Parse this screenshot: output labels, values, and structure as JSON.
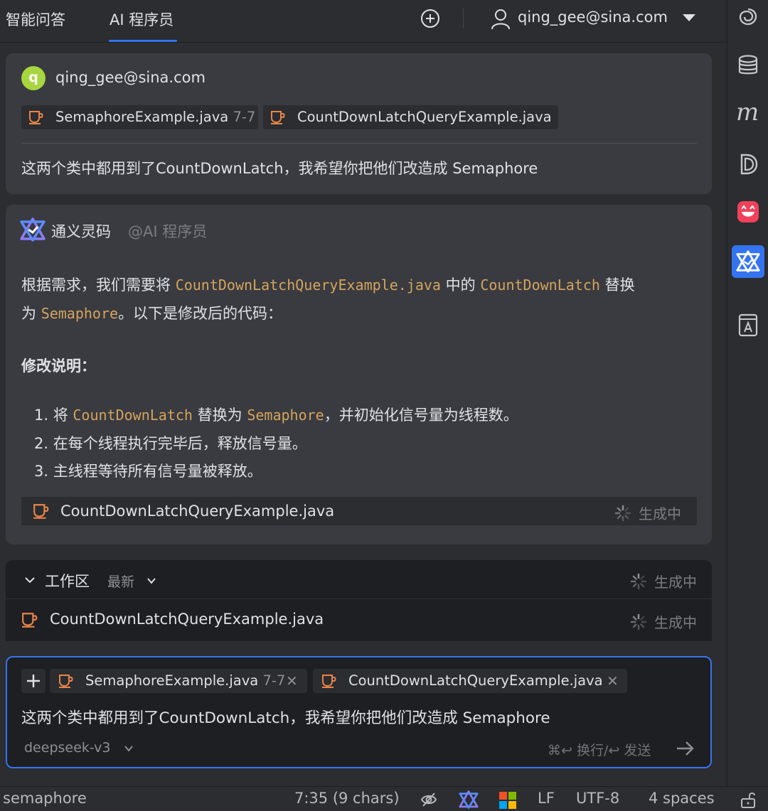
{
  "header": {
    "tabs": [
      {
        "label": "智能问答",
        "active": false
      },
      {
        "label": "AI 程序员",
        "active": true
      }
    ],
    "user_email": "qing_gee@sina.com"
  },
  "user_message": {
    "avatar_letter": "q",
    "user_name": "qing_gee@sina.com",
    "attachments": [
      {
        "file": "SemaphoreExample.java",
        "range": "7-7"
      },
      {
        "file": "CountDownLatchQueryExample.java",
        "range": ""
      }
    ],
    "text": "这两个类中都用到了CountDownLatch，我希望你把他们改造成 Semaphore"
  },
  "ai_message": {
    "name": "通义灵码",
    "mention": "@AI 程序员",
    "intro": {
      "p1": "根据需求，我们需要将 ",
      "c1": "CountDownLatchQueryExample.java",
      "p2": " 中的 ",
      "c2": "CountDownLatch",
      "p3": " 替换",
      "p4": "为 ",
      "c3": "Semaphore",
      "p5": "。以下是修改后的代码："
    },
    "section_title": "修改说明：",
    "steps": [
      {
        "n": "1. 将 ",
        "code1": "CountDownLatch",
        "mid": " 替换为 ",
        "code2": "Semaphore",
        "tail": "，并初始化信号量为线程数。"
      },
      {
        "text": "2. 在每个线程执行完毕后，释放信号量。"
      },
      {
        "text": "3. 主线程等待所有信号量被释放。"
      }
    ],
    "file": {
      "name": "CountDownLatchQueryExample.java",
      "status": "生成中"
    }
  },
  "workspace": {
    "title": "工作区",
    "filter": "最新",
    "status": "生成中",
    "files": [
      {
        "name": "CountDownLatchQueryExample.java",
        "status": "生成中"
      }
    ]
  },
  "input": {
    "attachments": [
      {
        "file": "SemaphoreExample.java",
        "range": "7-7"
      },
      {
        "file": "CountDownLatchQueryExample.java",
        "range": ""
      }
    ],
    "text": "这两个类中都用到了CountDownLatch，我希望你把他们改造成 Semaphore",
    "model": "deepseek-v3",
    "hint": "⌘↩ 换行/↩ 发送"
  },
  "status_bar": {
    "left": "semaphore",
    "position": "7:35 (9 chars)",
    "line_ending": "LF",
    "encoding": "UTF-8",
    "indent": "4 spaces"
  },
  "colors": {
    "accent": "#3574f0",
    "code": "#d6a35c",
    "avatar": "#a7d63f",
    "file_icon": "#e8844a"
  },
  "icons": {
    "right_bar": [
      "spiral-icon",
      "database-icon",
      "m-plugin-icon",
      "d-plugin-icon",
      "cat-plugin-icon",
      "tongyi-lingma-icon",
      "notebook-icon"
    ]
  }
}
